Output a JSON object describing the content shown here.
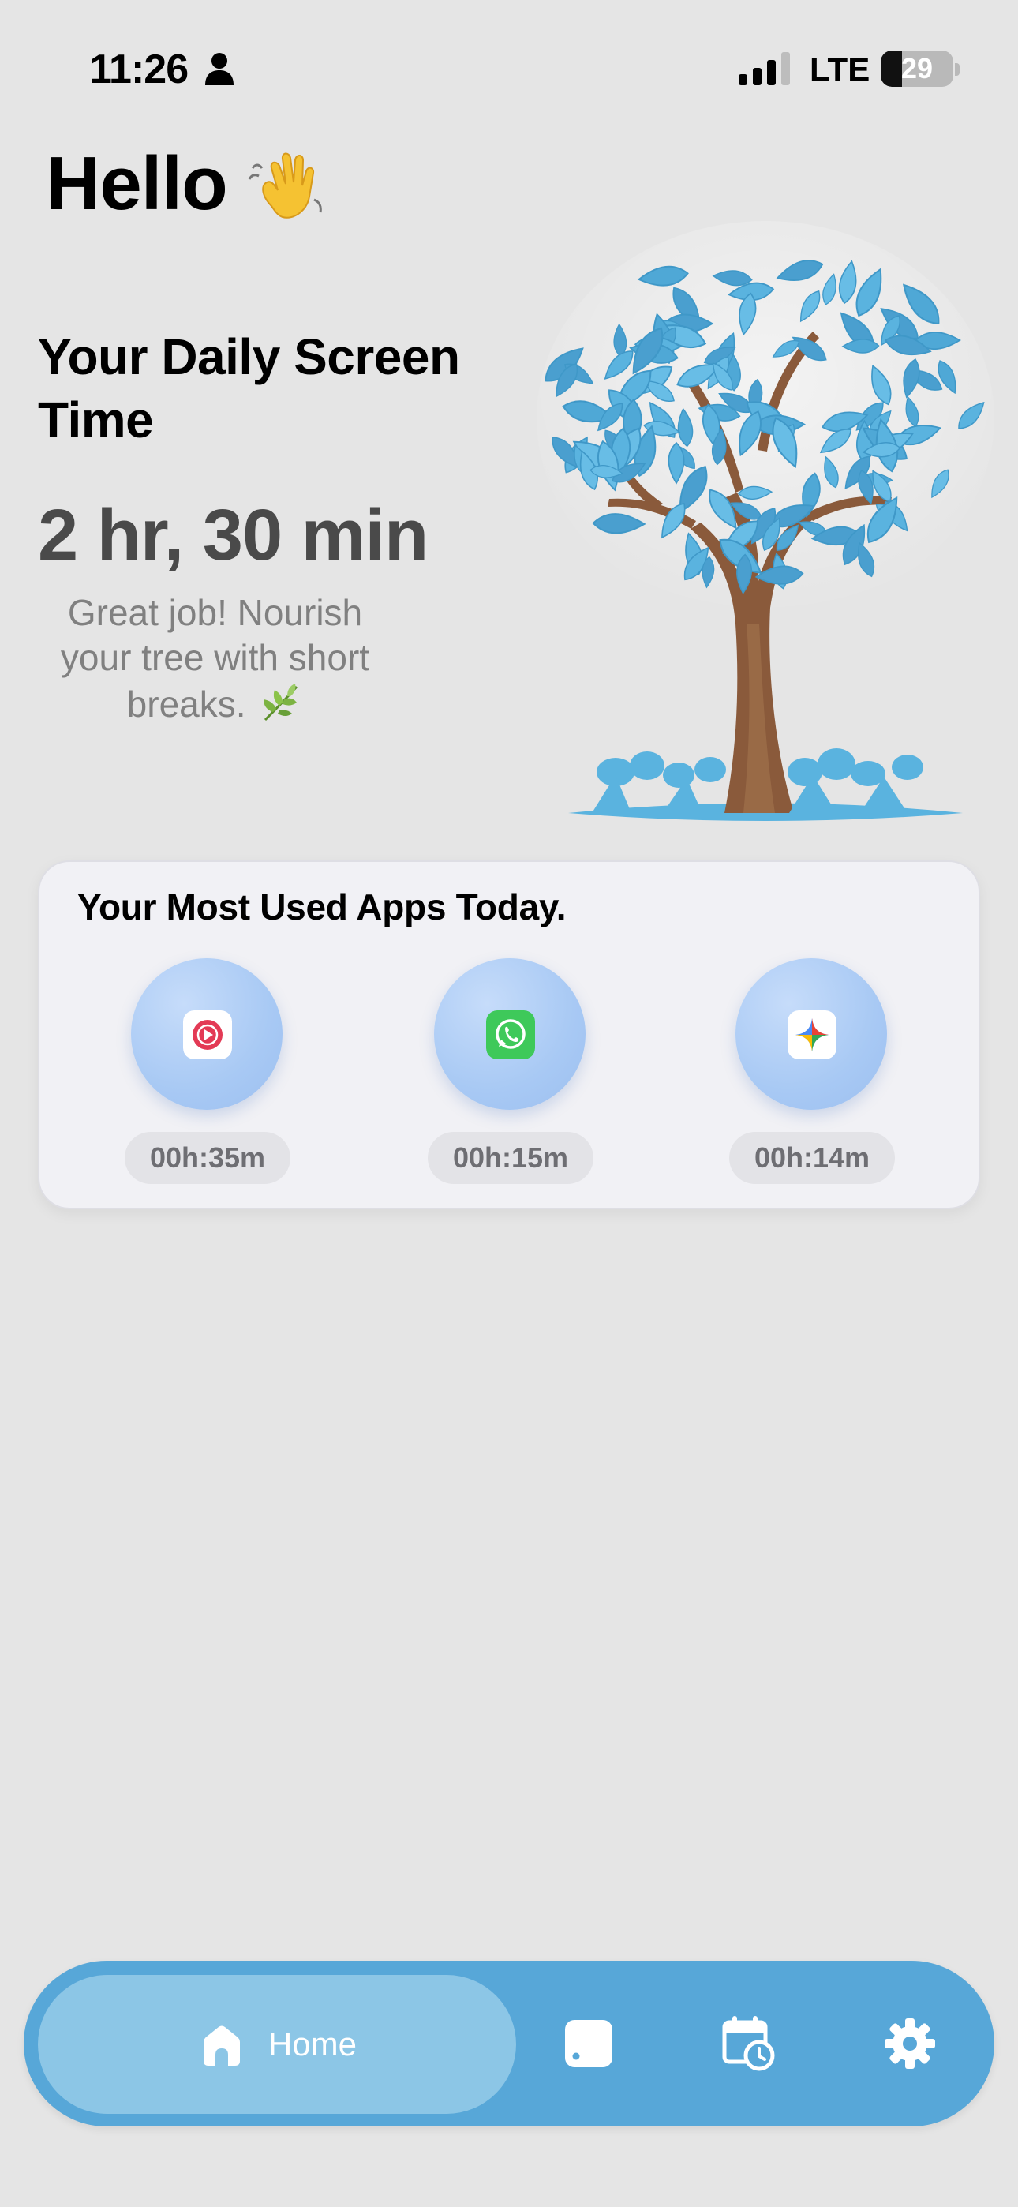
{
  "status_bar": {
    "time": "11:26",
    "network": "LTE",
    "battery_level": "29",
    "battery_fraction": 0.29
  },
  "header": {
    "greeting": "Hello",
    "greeting_icon": "waving-hand-icon"
  },
  "summary": {
    "title": "Your Daily Screen Time",
    "value": "2 hr, 30 min",
    "message": "Great job! Nourish your tree with short breaks.",
    "message_icon": "herb-leaf-icon"
  },
  "most_used": {
    "title": "Your Most Used Apps Today.",
    "apps": [
      {
        "icon": "youtube-music-icon",
        "time": "00h:35m"
      },
      {
        "icon": "whatsapp-icon",
        "time": "00h:15m"
      },
      {
        "icon": "gemini-icon",
        "time": "00h:14m"
      }
    ]
  },
  "tab_bar": {
    "active": "Home",
    "items": [
      {
        "label": "Home",
        "icon": "home-icon"
      },
      {
        "icon": "card-icon"
      },
      {
        "icon": "calendar-clock-icon"
      },
      {
        "icon": "gear-icon"
      }
    ]
  },
  "colors": {
    "background": "#e5e5e5",
    "tab_bar": "#57a7d8",
    "tab_active": "#8cc6e6",
    "leaf_blue": "#5ab3df",
    "app_circle": "#a8c9f4"
  }
}
